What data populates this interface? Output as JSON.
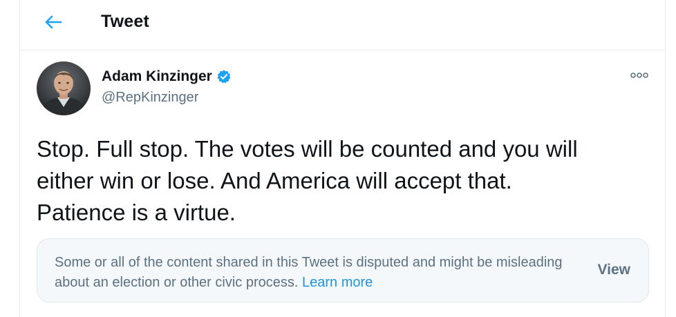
{
  "header": {
    "title": "Tweet",
    "back_icon": "arrow-left-icon",
    "accent_color": "#1da1f2"
  },
  "tweet": {
    "author_name": "Adam Kinzinger",
    "author_handle": "@RepKinzinger",
    "verified_icon": "verified-badge-icon",
    "more_icon": "more-options-icon",
    "text": "Stop.  Full stop. The votes will be counted and you will\neither win or lose.  And America will accept that.\nPatience is a virtue."
  },
  "notice": {
    "text": "Some or all of the content shared in this Tweet is disputed and might be misleading about an election or other civic process.",
    "link_label": "Learn more",
    "view_label": "View"
  },
  "colors": {
    "link": "#1b95e0",
    "secondary_text": "#5b7083",
    "notice_bg": "#f5f8fa",
    "border": "#e6ecf0"
  }
}
